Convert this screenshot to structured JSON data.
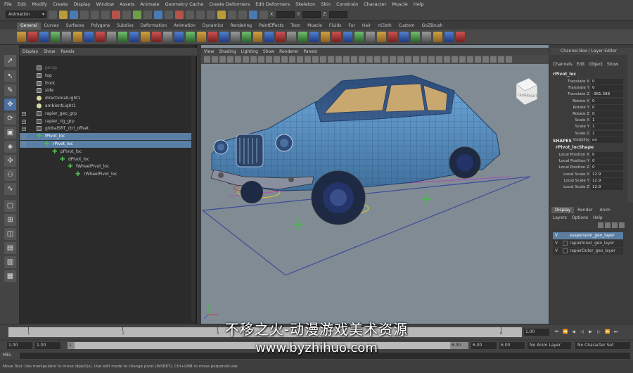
{
  "menu": [
    "File",
    "Edit",
    "Modify",
    "Create",
    "Display",
    "Window",
    "Assets",
    "Animate",
    "Geometry Cache",
    "Create Deformers",
    "Edit Deformers",
    "Skeleton",
    "Skin",
    "Constrain",
    "Character",
    "Muscle",
    "Help"
  ],
  "status": {
    "mode": "Animation",
    "x_label": "X:",
    "y_label": "Y:",
    "z_label": "Z:"
  },
  "shelf_tabs": [
    "General",
    "Curves",
    "Surfaces",
    "Polygons",
    "Subdivs",
    "Deformation",
    "Animation",
    "Dynamics",
    "Rendering",
    "PaintEffects",
    "Toon",
    "Muscle",
    "Fluids",
    "Fur",
    "Hair",
    "nCloth",
    "Custom",
    "GoZBrush"
  ],
  "outliner": {
    "menu": [
      "Display",
      "Show",
      "Panels"
    ],
    "items": [
      {
        "label": "persp",
        "icon": "camera-icon",
        "indent": 0,
        "dim": true
      },
      {
        "label": "top",
        "icon": "camera-icon",
        "indent": 0
      },
      {
        "label": "front",
        "icon": "camera-icon",
        "indent": 0
      },
      {
        "label": "side",
        "icon": "camera-icon",
        "indent": 0
      },
      {
        "label": "directionalLight1",
        "icon": "light-icon",
        "indent": 0
      },
      {
        "label": "ambientLight1",
        "icon": "light-icon",
        "indent": 0
      },
      {
        "label": "rapier_geo_grp",
        "icon": "group-icon",
        "indent": 0,
        "expander": "+"
      },
      {
        "label": "rapier_rig_grp",
        "icon": "group-icon",
        "indent": 0,
        "expander": "+"
      },
      {
        "label": "globalSRT_ctrl_offset",
        "icon": "group-icon",
        "indent": 0,
        "expander": "+"
      },
      {
        "label": "fPivot_loc",
        "icon": "locator-icon",
        "indent": 0,
        "expander": "-",
        "selected": true
      },
      {
        "label": "rPivot_loc",
        "icon": "locator-icon",
        "indent": 1,
        "expander": "-",
        "selected": true
      },
      {
        "label": "pPivot_loc",
        "icon": "locator-icon",
        "indent": 2
      },
      {
        "label": "dPivot_loc",
        "icon": "locator-icon",
        "indent": 3
      },
      {
        "label": "fWheelPivot_loc",
        "icon": "locator-icon",
        "indent": 4
      },
      {
        "label": "rWheelPivot_loc",
        "icon": "locator-icon",
        "indent": 5
      }
    ]
  },
  "viewport": {
    "menu": [
      "View",
      "Shading",
      "Lighting",
      "Show",
      "Renderer",
      "Panels"
    ],
    "viewcube_labels": [
      "FRONT",
      "RIGHT"
    ]
  },
  "channel_box": {
    "title": "Channel Box / Layer Editor",
    "menu": [
      "Channels",
      "Edit",
      "Object",
      "Show"
    ],
    "object": "rPivot_loc",
    "attributes": [
      {
        "label": "Translate X",
        "value": "0"
      },
      {
        "label": "Translate Y",
        "value": "0"
      },
      {
        "label": "Translate Z",
        "value": "-381.398"
      },
      {
        "label": "Rotate X",
        "value": "0"
      },
      {
        "label": "Rotate Y",
        "value": "0"
      },
      {
        "label": "Rotate Z",
        "value": "0"
      },
      {
        "label": "Scale X",
        "value": "1"
      },
      {
        "label": "Scale Y",
        "value": "1"
      },
      {
        "label": "Scale Z",
        "value": "1"
      },
      {
        "label": "Visibility",
        "value": "on"
      }
    ],
    "shapes_header": "SHAPES",
    "shape_name": "rPivot_locShape",
    "shape_attributes": [
      {
        "label": "Local Position X",
        "value": "0"
      },
      {
        "label": "Local Position Y",
        "value": "0"
      },
      {
        "label": "Local Position Z",
        "value": "0"
      },
      {
        "label": "Local Scale X",
        "value": "12.9"
      },
      {
        "label": "Local Scale Y",
        "value": "12.9"
      },
      {
        "label": "Local Scale Z",
        "value": "12.9"
      }
    ]
  },
  "layer_editor": {
    "tabs": [
      "Display",
      "Render",
      "Anim"
    ],
    "menu": [
      "Layers",
      "Options",
      "Help"
    ],
    "layers": [
      {
        "v": "V",
        "name": "suspension_geo_layer",
        "selected": true
      },
      {
        "v": "V",
        "name": "rapierInner_geo_layer"
      },
      {
        "v": "V",
        "name": "rapierOuter_geo_layer"
      }
    ]
  },
  "time_slider": {
    "ticks": [
      "1",
      "2",
      "3",
      "4",
      "5",
      "6"
    ],
    "current": "1.00"
  },
  "range_slider": {
    "start": "1.00",
    "start2": "1.00",
    "handle": "1",
    "end_inner": "6.00",
    "end": "6.00",
    "end2": "6.00",
    "anim_layer": "No Anim Layer",
    "char_set": "No Character Set"
  },
  "command_line": {
    "label": "MEL"
  },
  "help_line": "Move Tool: Use manipulator to move object(s). Use edit mode to change pivot (INSERT). Ctrl+LMB to move perpendicular.",
  "watermark": {
    "line1": "不移之火-动漫游戏美术资源",
    "line2": "www.byzhihuo.com"
  }
}
